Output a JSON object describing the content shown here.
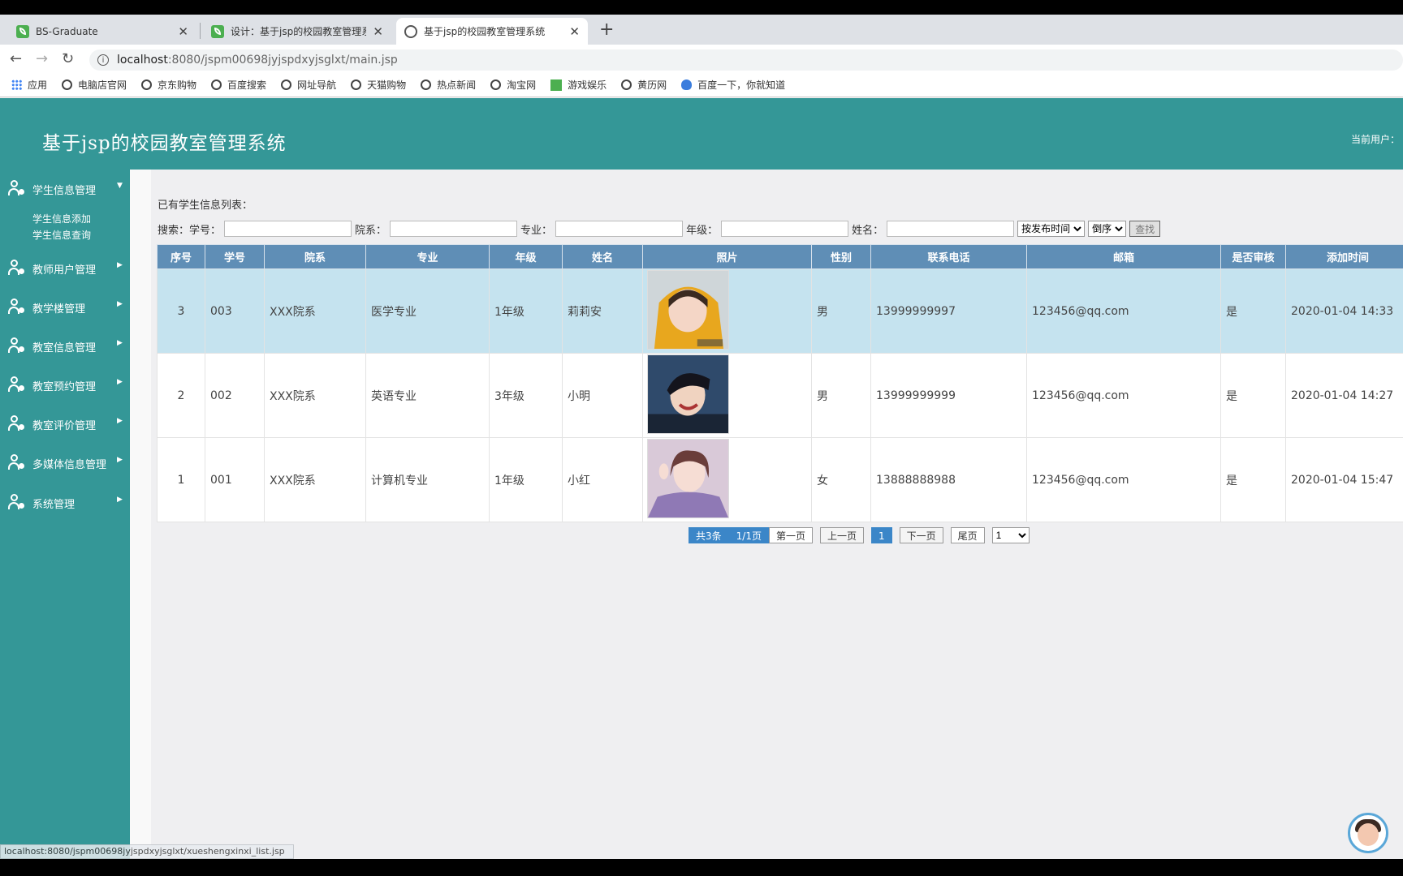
{
  "browser": {
    "tabs": [
      {
        "title": "BS-Graduate",
        "favicon": "leaf-icon"
      },
      {
        "title": "设计：基于jsp的校园教室管理系",
        "favicon": "leaf-icon"
      },
      {
        "title": "基于jsp的校园教室管理系统",
        "favicon": "globe-icon"
      }
    ],
    "close_glyph": "✕",
    "new_tab_glyph": "+",
    "url_host": "localhost",
    "url_path": ":8080/jspm00698jyjspdxyjsglxt/main.jsp",
    "bookmarks": [
      "应用",
      "电脑店官网",
      "京东购物",
      "百度搜索",
      "网址导航",
      "天猫购物",
      "热点新闻",
      "淘宝网",
      "游戏娱乐",
      "黄历网",
      "百度一下，你就知道"
    ],
    "status_url": "localhost:8080/jspm00698jyjspdxyjsglxt/xueshengxinxi_list.jsp"
  },
  "header": {
    "title": "基于jsp的校园教室管理系统",
    "user_label": "当前用户："
  },
  "sidebar": {
    "menus": [
      {
        "label": "学生信息管理",
        "expanded": true
      },
      {
        "label": "教师用户管理"
      },
      {
        "label": "教学楼管理"
      },
      {
        "label": "教室信息管理"
      },
      {
        "label": "教室预约管理"
      },
      {
        "label": "教室评价管理"
      },
      {
        "label": "多媒体信息管理"
      },
      {
        "label": "系统管理"
      }
    ],
    "submenu": [
      "学生信息添加",
      "学生信息查询"
    ]
  },
  "main": {
    "list_title": "已有学生信息列表：",
    "search": {
      "prefix": "搜索：",
      "fields": [
        "学号：",
        "院系：",
        "专业：",
        "年级：",
        "姓名："
      ],
      "sort_field": "按发布时间",
      "sort_order": "倒序",
      "find_button": "查找"
    },
    "table": {
      "headers": [
        "序号",
        "学号",
        "院系",
        "专业",
        "年级",
        "姓名",
        "照片",
        "性别",
        "联系电话",
        "邮箱",
        "是否审核",
        "添加时间"
      ],
      "rows": [
        {
          "seq": "3",
          "id": "003",
          "dept": "XXX院系",
          "major": "医学专业",
          "grade": "1年级",
          "name": "莉莉安",
          "photo": "photo-girl-yellow-hood",
          "gender": "男",
          "phone": "13999999997",
          "email": "123456@qq.com",
          "audited": "是",
          "time": "2020-01-04 14:33",
          "highlight": true
        },
        {
          "seq": "2",
          "id": "002",
          "dept": "XXX院系",
          "major": "英语专业",
          "grade": "3年级",
          "name": "小明",
          "photo": "photo-boy-smiling",
          "gender": "男",
          "phone": "13999999999",
          "email": "123456@qq.com",
          "audited": "是",
          "time": "2020-01-04 14:27"
        },
        {
          "seq": "1",
          "id": "001",
          "dept": "XXX院系",
          "major": "计算机专业",
          "grade": "1年级",
          "name": "小红",
          "photo": "photo-girl-purple",
          "gender": "女",
          "phone": "13888888988",
          "email": "123456@qq.com",
          "audited": "是",
          "time": "2020-01-04 15:47"
        }
      ]
    },
    "pager": {
      "total": "共3条",
      "pages": "1/1页",
      "first": "第一页",
      "prev": "上一页",
      "current": "1",
      "next": "下一页",
      "last": "尾页",
      "jump": "1"
    }
  },
  "colors": {
    "header_bg": "#349797",
    "table_header_bg": "#5f8eb6",
    "row_highlight": "#c5e3ef",
    "pager_active": "#3b86c8"
  }
}
